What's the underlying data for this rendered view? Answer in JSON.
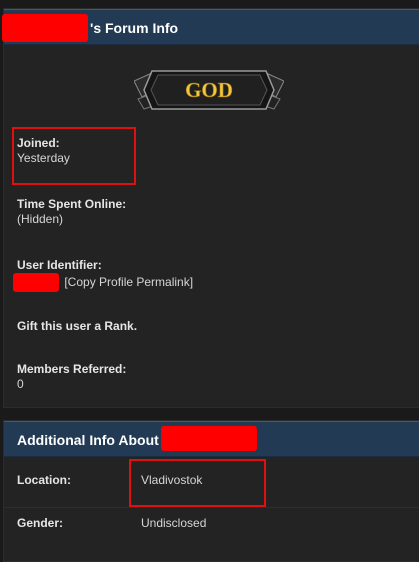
{
  "forum_panel": {
    "title_suffix": "'s Forum Info",
    "badge_text": "GOD",
    "joined": {
      "label": "Joined:",
      "value": "Yesterday"
    },
    "time_online": {
      "label": "Time Spent Online:",
      "value": "(Hidden)"
    },
    "user_identifier": {
      "label": "User Identifier:",
      "copy_link": "[Copy Profile Permalink]"
    },
    "gift_rank": "Gift this user a Rank.",
    "members_referred": {
      "label": "Members Referred:",
      "value": "0"
    }
  },
  "additional_panel": {
    "title_prefix": "Additional Info About",
    "rows": [
      {
        "label": "Location:",
        "value": "Vladivostok"
      },
      {
        "label": "Gender:",
        "value": "Undisclosed"
      }
    ]
  },
  "colors": {
    "header_bg": "#233a55",
    "redaction": "#ff0000",
    "highlight_box": "#e01010",
    "badge_gold": "#f2c640"
  }
}
